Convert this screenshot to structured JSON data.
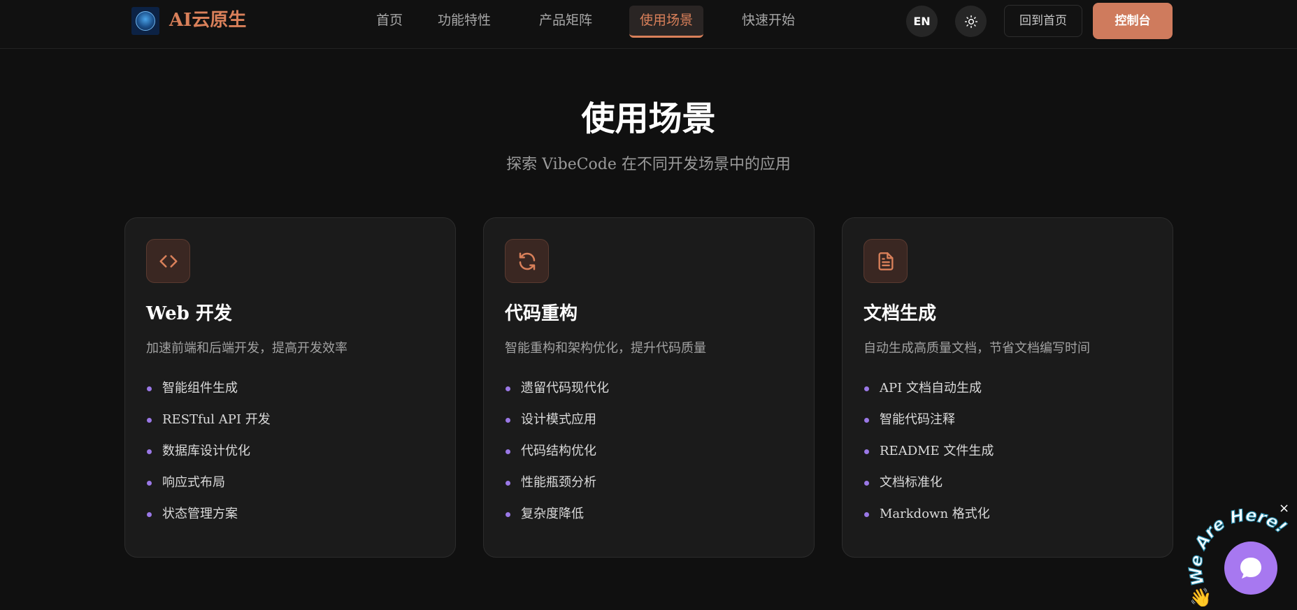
{
  "header": {
    "brand": "AI云原生",
    "nav": [
      {
        "label": "首页",
        "active": false
      },
      {
        "label": "功能特性",
        "active": false
      },
      {
        "label": "产品矩阵",
        "active": false
      },
      {
        "label": "使用场景",
        "active": true
      },
      {
        "label": "快速开始",
        "active": false
      }
    ],
    "lang_button": "EN",
    "theme_icon": "sun-icon",
    "home_button": "回到首页",
    "console_button": "控制台"
  },
  "section": {
    "title": "使用场景",
    "subtitle": "探索 VibeCode 在不同开发场景中的应用"
  },
  "cards": [
    {
      "icon": "code-icon",
      "title": "Web 开发",
      "description": "加速前端和后端开发，提高开发效率",
      "items": [
        "智能组件生成",
        "RESTful API 开发",
        "数据库设计优化",
        "响应式布局",
        "状态管理方案"
      ]
    },
    {
      "icon": "refresh-icon",
      "title": "代码重构",
      "description": "智能重构和架构优化，提升代码质量",
      "items": [
        "遗留代码现代化",
        "设计模式应用",
        "代码结构优化",
        "性能瓶颈分析",
        "复杂度降低"
      ]
    },
    {
      "icon": "document-icon",
      "title": "文档生成",
      "description": "自动生成高质量文档，节省文档编写时间",
      "items": [
        "API 文档自动生成",
        "智能代码注释",
        "README 文件生成",
        "文档标准化",
        "Markdown 格式化"
      ]
    }
  ],
  "chat_widget": {
    "badge_text": "We Are Here!",
    "close_label": "×"
  },
  "colors": {
    "accent": "#d9805a",
    "bullet": "#9a78e6",
    "chat": "#a778f0",
    "background": "#101010"
  }
}
